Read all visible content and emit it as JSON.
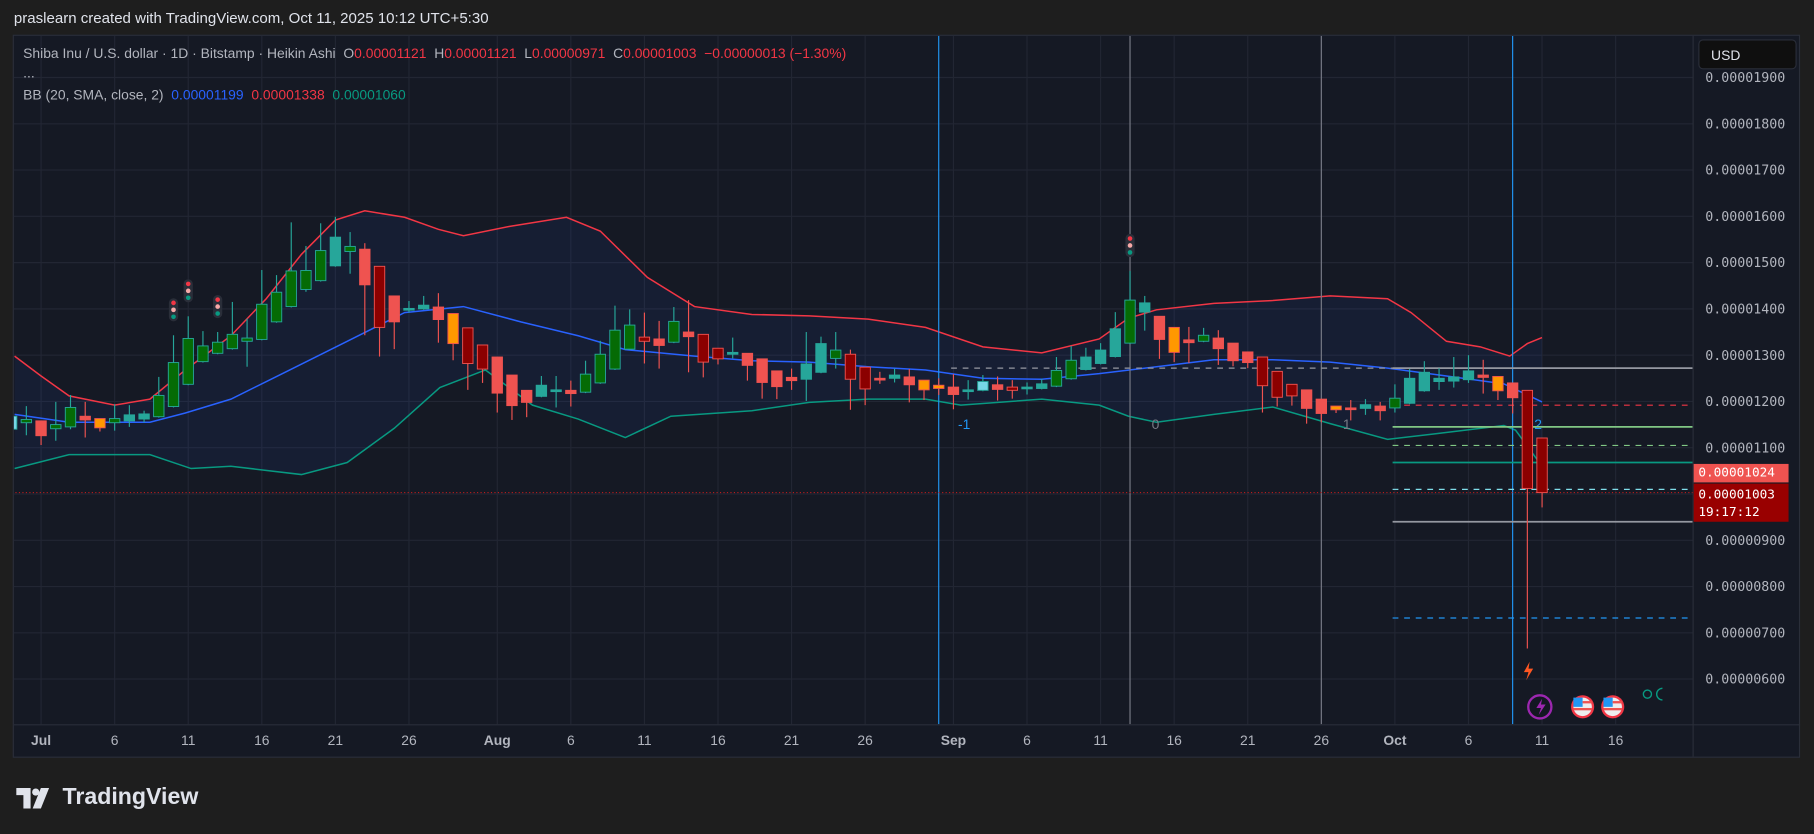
{
  "header": {
    "credit": "praslearn created with TradingView.com, Oct 11, 2025 10:12 UTC+5:30"
  },
  "legend": {
    "symbol": "Shiba Inu / U.S. dollar · 1D · Bitstamp · Heikin Ashi",
    "o_label": "O",
    "o": "0.00001121",
    "h_label": "H",
    "h": "0.00001121",
    "l_label": "L",
    "l": "0.00000971",
    "c_label": "C",
    "c": "0.00001003",
    "change": "−0.00000013 (−1.30%)",
    "more": "...",
    "bb_label": "BB (20, SMA, close, 2)",
    "bb_basis": "0.00001199",
    "bb_upper": "0.00001338",
    "bb_lower": "0.00001060"
  },
  "currency_button": "USD",
  "price_axis": [
    "0.00001900",
    "0.00001800",
    "0.00001700",
    "0.00001600",
    "0.00001500",
    "0.00001400",
    "0.00001300",
    "0.00001200",
    "0.00001100",
    "0.00000900",
    "0.00000800",
    "0.00000700",
    "0.00000600"
  ],
  "price_axis_values_e8": [
    1900,
    1800,
    1700,
    1600,
    1500,
    1400,
    1300,
    1200,
    1100,
    900,
    800,
    700,
    600
  ],
  "badges": {
    "bb_price": "0.00001024",
    "last_price": "0.00001003",
    "countdown": "19:17:12"
  },
  "time_axis": [
    {
      "label": "Jul",
      "day": 0,
      "bold": true
    },
    {
      "label": "6",
      "day": 5
    },
    {
      "label": "11",
      "day": 10
    },
    {
      "label": "16",
      "day": 15
    },
    {
      "label": "21",
      "day": 20
    },
    {
      "label": "26",
      "day": 25
    },
    {
      "label": "Aug",
      "day": 31,
      "bold": true
    },
    {
      "label": "6",
      "day": 36
    },
    {
      "label": "11",
      "day": 41
    },
    {
      "label": "16",
      "day": 46
    },
    {
      "label": "21",
      "day": 51
    },
    {
      "label": "26",
      "day": 56
    },
    {
      "label": "Sep",
      "day": 62,
      "bold": true
    },
    {
      "label": "6",
      "day": 67
    },
    {
      "label": "11",
      "day": 72
    },
    {
      "label": "16",
      "day": 77
    },
    {
      "label": "21",
      "day": 82
    },
    {
      "label": "26",
      "day": 87
    },
    {
      "label": "Oct",
      "day": 92,
      "bold": true
    },
    {
      "label": "6",
      "day": 97
    },
    {
      "label": "11",
      "day": 102
    },
    {
      "label": "16",
      "day": 107
    }
  ],
  "fib_time_zones": [
    {
      "label": "-1",
      "day": 61,
      "color": "#2196f3"
    },
    {
      "label": "0",
      "day": 74,
      "color": "#787b86"
    },
    {
      "label": "1",
      "day": 87,
      "color": "#787b86"
    },
    {
      "label": "2",
      "day": 100,
      "color": "#2196f3"
    }
  ],
  "horizontal_levels_e8": [
    {
      "value": 1272,
      "color": "#9598a1",
      "style": "solid",
      "from_day": 92
    },
    {
      "value": 1272,
      "color": "#9598a1",
      "style": "dashed",
      "from_day": 62,
      "to_day": 92
    },
    {
      "value": 1192,
      "color": "#f23645",
      "style": "dashed",
      "from_day": 92
    },
    {
      "value": 1145,
      "color": "#81c784",
      "style": "solid",
      "from_day": 92
    },
    {
      "value": 1105,
      "color": "#81c784",
      "style": "dashed",
      "from_day": 92
    },
    {
      "value": 1068,
      "color": "#089981",
      "style": "solid",
      "from_day": 92
    },
    {
      "value": 1010,
      "color": "#80deea",
      "style": "dashed",
      "from_day": 92
    },
    {
      "value": 1003,
      "color": "#b71c1c",
      "style": "dotted",
      "from_day": -3
    },
    {
      "value": 940,
      "color": "#9598a1",
      "style": "solid",
      "from_day": 92
    },
    {
      "value": 732,
      "color": "#2196f3",
      "style": "dashed",
      "from_day": 92
    }
  ],
  "signal_markers_days": [
    9,
    10,
    12,
    74
  ],
  "colors": {
    "up": "#26a69a",
    "down": "#ef5350",
    "green_body": "#056b05",
    "dark_red_body": "#8b0000",
    "orange": "#ff9800",
    "cyan": "#76d6e6",
    "bb_basis": "#2962ff",
    "bb_upper": "#f23645",
    "bb_lower": "#089981"
  },
  "brand": "TradingView",
  "chart_data": {
    "type": "candlestick",
    "title": "Shiba Inu / U.S. dollar · 1D · Bitstamp · Heikin Ashi",
    "price_unit": "1e-8 USD",
    "start_day": -2,
    "start_date": "Jun 29",
    "ylim": [
      560,
      1920
    ],
    "candles_ohlc_style": [
      [
        1140,
        1168,
        1135,
        1168,
        "c"
      ],
      [
        1154,
        1190,
        1127,
        1161,
        "g"
      ],
      [
        1158,
        1158,
        1106,
        1126,
        "r"
      ],
      [
        1141,
        1199,
        1115,
        1150,
        "g"
      ],
      [
        1145,
        1214,
        1140,
        1187,
        "g"
      ],
      [
        1168,
        1199,
        1122,
        1160,
        "r"
      ],
      [
        1163,
        1163,
        1135,
        1143,
        "o"
      ],
      [
        1154,
        1194,
        1137,
        1163,
        "g"
      ],
      [
        1158,
        1192,
        1145,
        1171,
        "t"
      ],
      [
        1162,
        1180,
        1155,
        1173,
        "t"
      ],
      [
        1167,
        1253,
        1165,
        1213,
        "g"
      ],
      [
        1189,
        1343,
        1187,
        1284,
        "g"
      ],
      [
        1237,
        1384,
        1235,
        1336,
        "g"
      ],
      [
        1286,
        1352,
        1284,
        1320,
        "g"
      ],
      [
        1304,
        1350,
        1302,
        1328,
        "g"
      ],
      [
        1314,
        1415,
        1312,
        1345,
        "g"
      ],
      [
        1330,
        1379,
        1275,
        1337,
        "g"
      ],
      [
        1334,
        1484,
        1332,
        1410,
        "g"
      ],
      [
        1372,
        1473,
        1370,
        1436,
        "g"
      ],
      [
        1405,
        1587,
        1403,
        1482,
        "g"
      ],
      [
        1442,
        1536,
        1437,
        1483,
        "g"
      ],
      [
        1461,
        1585,
        1459,
        1526,
        "g"
      ],
      [
        1493,
        1599,
        1491,
        1555,
        "t"
      ],
      [
        1524,
        1566,
        1476,
        1535,
        "g"
      ],
      [
        1529,
        1542,
        1343,
        1452,
        "r"
      ],
      [
        1492,
        1492,
        1297,
        1360,
        "dr"
      ],
      [
        1428,
        1428,
        1313,
        1372,
        "r"
      ],
      [
        1399,
        1417,
        1392,
        1401,
        "t"
      ],
      [
        1400,
        1428,
        1398,
        1408,
        "t"
      ],
      [
        1404,
        1434,
        1327,
        1377,
        "r"
      ],
      [
        1390,
        1390,
        1289,
        1325,
        "o"
      ],
      [
        1359,
        1359,
        1225,
        1282,
        "dr"
      ],
      [
        1322,
        1322,
        1240,
        1270,
        "dr"
      ],
      [
        1296,
        1296,
        1176,
        1218,
        "r"
      ],
      [
        1257,
        1257,
        1160,
        1191,
        "r"
      ],
      [
        1224,
        1224,
        1166,
        1198,
        "r"
      ],
      [
        1211,
        1255,
        1209,
        1235,
        "t"
      ],
      [
        1224,
        1255,
        1187,
        1225,
        "t"
      ],
      [
        1224,
        1245,
        1189,
        1217,
        "r"
      ],
      [
        1220,
        1288,
        1218,
        1259,
        "g"
      ],
      [
        1240,
        1331,
        1238,
        1302,
        "g"
      ],
      [
        1270,
        1407,
        1268,
        1354,
        "g"
      ],
      [
        1313,
        1399,
        1311,
        1365,
        "g"
      ],
      [
        1339,
        1392,
        1282,
        1330,
        "dr"
      ],
      [
        1335,
        1374,
        1271,
        1321,
        "r"
      ],
      [
        1328,
        1404,
        1326,
        1373,
        "g"
      ],
      [
        1350,
        1419,
        1263,
        1340,
        "r"
      ],
      [
        1345,
        1345,
        1252,
        1285,
        "dr"
      ],
      [
        1315,
        1315,
        1280,
        1292,
        "dr"
      ],
      [
        1302,
        1338,
        1293,
        1306,
        "t"
      ],
      [
        1304,
        1304,
        1245,
        1278,
        "r"
      ],
      [
        1292,
        1292,
        1206,
        1241,
        "r"
      ],
      [
        1266,
        1266,
        1205,
        1232,
        "r"
      ],
      [
        1252,
        1271,
        1225,
        1245,
        "r"
      ],
      [
        1248,
        1350,
        1201,
        1281,
        "t"
      ],
      [
        1263,
        1340,
        1261,
        1325,
        "t"
      ],
      [
        1293,
        1350,
        1271,
        1311,
        "g"
      ],
      [
        1302,
        1312,
        1182,
        1248,
        "dr"
      ],
      [
        1274,
        1274,
        1192,
        1227,
        "dr"
      ],
      [
        1250,
        1264,
        1238,
        1249,
        "r"
      ],
      [
        1250,
        1271,
        1241,
        1257,
        "t"
      ],
      [
        1253,
        1270,
        1198,
        1236,
        "r"
      ],
      [
        1246,
        1246,
        1203,
        1225,
        "o"
      ],
      [
        1235,
        1250,
        1214,
        1228,
        "o"
      ],
      [
        1231,
        1259,
        1183,
        1215,
        "r"
      ],
      [
        1224,
        1246,
        1204,
        1225,
        "t"
      ],
      [
        1224,
        1257,
        1222,
        1243,
        "c"
      ],
      [
        1236,
        1254,
        1202,
        1226,
        "r"
      ],
      [
        1231,
        1246,
        1206,
        1224,
        "dr"
      ],
      [
        1230,
        1241,
        1215,
        1231,
        "t"
      ],
      [
        1228,
        1249,
        1226,
        1238,
        "t"
      ],
      [
        1233,
        1296,
        1231,
        1267,
        "g"
      ],
      [
        1249,
        1320,
        1247,
        1289,
        "g"
      ],
      [
        1269,
        1316,
        1267,
        1296,
        "t"
      ],
      [
        1282,
        1326,
        1280,
        1311,
        "t"
      ],
      [
        1297,
        1393,
        1295,
        1357,
        "t"
      ],
      [
        1326,
        1482,
        1324,
        1419,
        "g"
      ],
      [
        1393,
        1428,
        1353,
        1413,
        "t"
      ],
      [
        1384,
        1384,
        1292,
        1334,
        "r"
      ],
      [
        1360,
        1360,
        1285,
        1306,
        "o"
      ],
      [
        1333,
        1361,
        1283,
        1327,
        "r"
      ],
      [
        1330,
        1359,
        1328,
        1343,
        "g"
      ],
      [
        1337,
        1354,
        1279,
        1314,
        "r"
      ],
      [
        1326,
        1326,
        1276,
        1288,
        "r"
      ],
      [
        1307,
        1307,
        1272,
        1284,
        "r"
      ],
      [
        1296,
        1296,
        1176,
        1234,
        "dr"
      ],
      [
        1265,
        1265,
        1189,
        1209,
        "dr"
      ],
      [
        1237,
        1237,
        1191,
        1212,
        "dr"
      ],
      [
        1225,
        1225,
        1152,
        1185,
        "r"
      ],
      [
        1205,
        1205,
        1155,
        1174,
        "r"
      ],
      [
        1190,
        1190,
        1175,
        1182,
        "o"
      ],
      [
        1185,
        1203,
        1159,
        1186,
        "r"
      ],
      [
        1185,
        1205,
        1171,
        1193,
        "t"
      ],
      [
        1190,
        1199,
        1159,
        1180,
        "r"
      ],
      [
        1186,
        1237,
        1176,
        1207,
        "g"
      ],
      [
        1196,
        1270,
        1194,
        1250,
        "t"
      ],
      [
        1223,
        1287,
        1221,
        1263,
        "t"
      ],
      [
        1243,
        1272,
        1225,
        1250,
        "t"
      ],
      [
        1244,
        1296,
        1230,
        1253,
        "t"
      ],
      [
        1247,
        1300,
        1240,
        1266,
        "t"
      ],
      [
        1257,
        1290,
        1217,
        1252,
        "r"
      ],
      [
        1254,
        1254,
        1203,
        1223,
        "o"
      ],
      [
        1240,
        1240,
        1174,
        1208,
        "r"
      ],
      [
        1224,
        1224,
        666,
        1012,
        "dr"
      ],
      [
        1121,
        1121,
        971,
        1003,
        "dr"
      ]
    ],
    "bollinger_bands": {
      "params": "BB (20, SMA, close, 2)",
      "upper": [
        [
          -1.8,
          1298
        ],
        [
          0,
          1255
        ],
        [
          1.9,
          1212
        ],
        [
          5,
          1192
        ],
        [
          7.4,
          1205
        ],
        [
          9.8,
          1268
        ],
        [
          12.9,
          1342
        ],
        [
          15.3,
          1422
        ],
        [
          17.7,
          1518
        ],
        [
          20,
          1592
        ],
        [
          22,
          1612
        ],
        [
          24.7,
          1598
        ],
        [
          27,
          1572
        ],
        [
          28.7,
          1558
        ],
        [
          31.8,
          1578
        ],
        [
          35.7,
          1598
        ],
        [
          38,
          1568
        ],
        [
          41.2,
          1468
        ],
        [
          44.4,
          1405
        ],
        [
          48.3,
          1388
        ],
        [
          52.2,
          1385
        ],
        [
          56.2,
          1378
        ],
        [
          60.1,
          1360
        ],
        [
          64,
          1318
        ],
        [
          68,
          1305
        ],
        [
          71.9,
          1335
        ],
        [
          73.9,
          1380
        ],
        [
          75.8,
          1398
        ],
        [
          79.7,
          1412
        ],
        [
          83.7,
          1418
        ],
        [
          87.6,
          1428
        ],
        [
          91.5,
          1422
        ],
        [
          93.1,
          1392
        ],
        [
          95.5,
          1330
        ],
        [
          97.8,
          1318
        ],
        [
          99.8,
          1298
        ],
        [
          101,
          1325
        ],
        [
          102,
          1338
        ]
      ],
      "basis": [
        [
          -1.8,
          1172
        ],
        [
          1.9,
          1155
        ],
        [
          7.4,
          1155
        ],
        [
          9.8,
          1175
        ],
        [
          12.9,
          1205
        ],
        [
          16.9,
          1268
        ],
        [
          20.8,
          1330
        ],
        [
          24.7,
          1392
        ],
        [
          28.7,
          1405
        ],
        [
          32.6,
          1372
        ],
        [
          36.5,
          1342
        ],
        [
          39.7,
          1312
        ],
        [
          44.4,
          1298
        ],
        [
          48.3,
          1288
        ],
        [
          52.2,
          1285
        ],
        [
          56.2,
          1275
        ],
        [
          60.1,
          1268
        ],
        [
          64,
          1250
        ],
        [
          68,
          1248
        ],
        [
          71.9,
          1260
        ],
        [
          75.8,
          1275
        ],
        [
          79.7,
          1290
        ],
        [
          83.7,
          1290
        ],
        [
          87.6,
          1285
        ],
        [
          91.5,
          1272
        ],
        [
          95.5,
          1255
        ],
        [
          99.4,
          1238
        ],
        [
          102,
          1199
        ]
      ],
      "lower": [
        [
          -1.8,
          1055
        ],
        [
          1.9,
          1085
        ],
        [
          7.4,
          1085
        ],
        [
          10.2,
          1055
        ],
        [
          12.9,
          1060
        ],
        [
          17.7,
          1042
        ],
        [
          20.8,
          1068
        ],
        [
          24,
          1142
        ],
        [
          27.1,
          1230
        ],
        [
          30.2,
          1268
        ],
        [
          33.4,
          1192
        ],
        [
          36.5,
          1162
        ],
        [
          39.7,
          1122
        ],
        [
          42.8,
          1168
        ],
        [
          48.3,
          1180
        ],
        [
          52.2,
          1198
        ],
        [
          56.2,
          1205
        ],
        [
          60.1,
          1205
        ],
        [
          62.5,
          1192
        ],
        [
          68,
          1205
        ],
        [
          71.9,
          1192
        ],
        [
          73.9,
          1168
        ],
        [
          75.8,
          1155
        ],
        [
          79.7,
          1172
        ],
        [
          83.7,
          1188
        ],
        [
          87.6,
          1152
        ],
        [
          91.5,
          1118
        ],
        [
          94.7,
          1130
        ],
        [
          99.4,
          1148
        ],
        [
          100.2,
          1138
        ],
        [
          102,
          1060
        ]
      ]
    }
  }
}
